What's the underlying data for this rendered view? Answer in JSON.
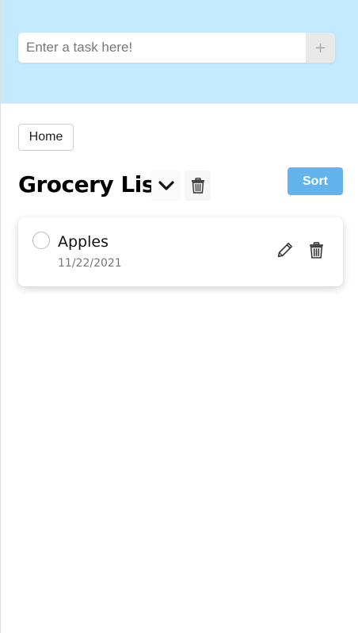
{
  "task_input": {
    "placeholder": "Enter a task here!",
    "value": ""
  },
  "add_button": {
    "label": "+"
  },
  "nav": {
    "home_label": "Home"
  },
  "list": {
    "title": "Grocery List",
    "sort_label": "Sort",
    "items": [
      {
        "name": "Apples",
        "date": "11/22/2021",
        "completed": false
      }
    ]
  },
  "colors": {
    "header_bg": "#c3eaff",
    "sort_button": "#63b3ed",
    "add_button_bg": "#e9e9e9"
  },
  "icons": {
    "list_dropdown": "chevron-down-icon",
    "list_delete": "trash-icon",
    "item_edit": "pencil-icon",
    "item_delete": "trash-icon"
  }
}
